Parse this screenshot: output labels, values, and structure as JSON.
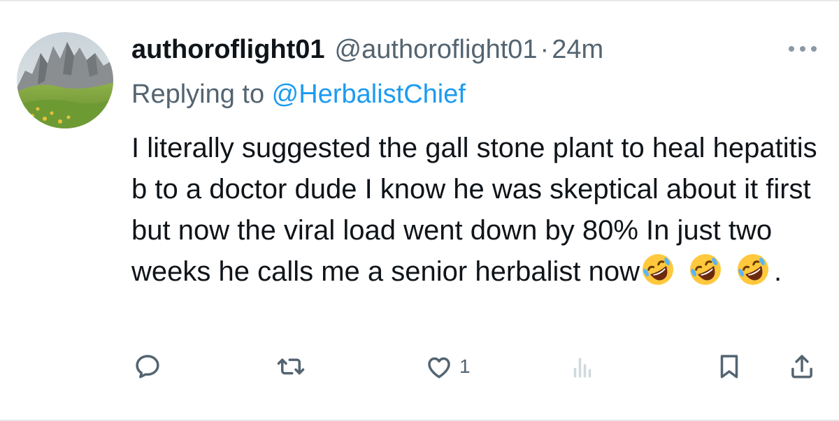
{
  "tweet": {
    "display_name": "authoroflight01",
    "handle": "@authoroflight01",
    "separator": "·",
    "timestamp": "24m",
    "reply_prefix": "Replying to ",
    "reply_mention": "@HerbalistChief",
    "text": "I literally suggested the gall stone plant to heal hepatitis b to a doctor dude I know he was skeptical about it first but now the viral load went down by 80% In just two weeks he calls me a senior herbalist now",
    "text_trailing": ".",
    "emojis": [
      "rolling-on-floor-laughing",
      "rolling-on-floor-laughing",
      "rolling-on-floor-laughing"
    ]
  },
  "actions": {
    "reply": {
      "icon": "reply-icon"
    },
    "retweet": {
      "icon": "retweet-icon"
    },
    "like": {
      "icon": "heart-icon",
      "count": "1"
    },
    "views": {
      "icon": "analytics-icon"
    },
    "bookmark": {
      "icon": "bookmark-icon"
    },
    "share": {
      "icon": "share-icon"
    }
  },
  "colors": {
    "accent": "#1d9bf0",
    "secondary_text": "#536471",
    "primary_text": "#0f1419",
    "divider": "#e7e9ea"
  }
}
